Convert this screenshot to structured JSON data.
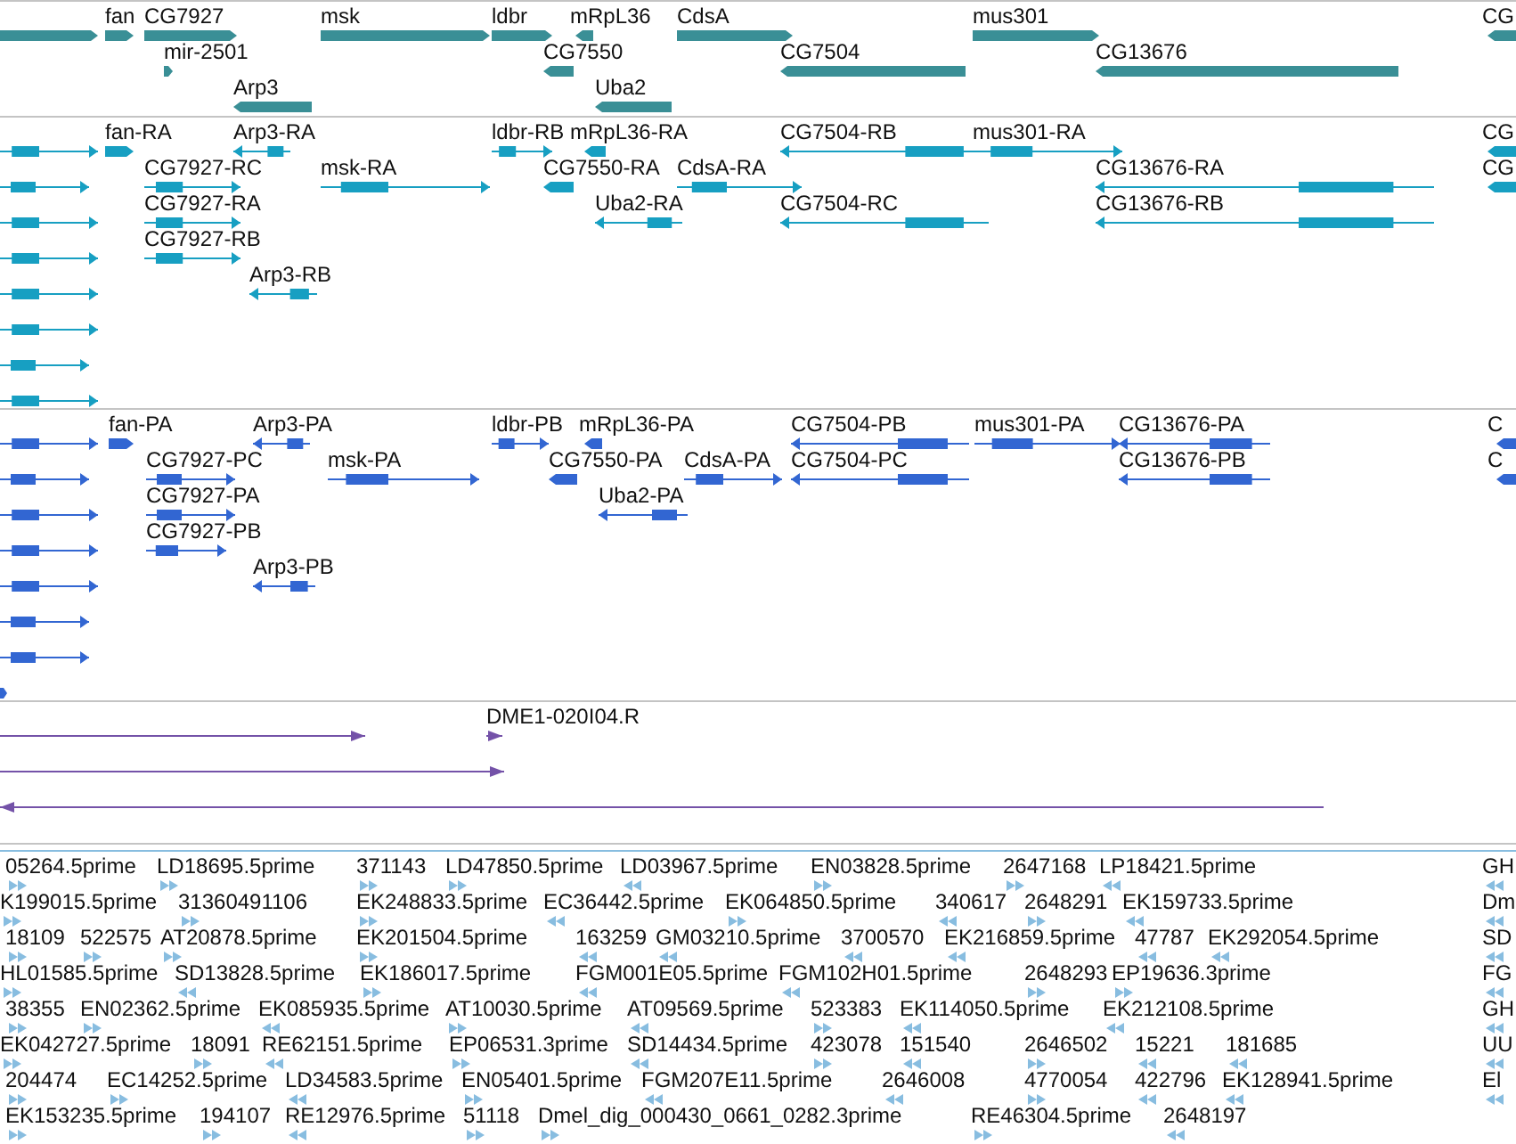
{
  "tracks": [
    {
      "kind": "gene",
      "color": "#3a8f96",
      "lanes": [
        {
          "features": [
            {
              "reverse": false
            },
            {
              "label": "fan",
              "reverse": false
            },
            {
              "label": "CG7927",
              "reverse": false
            },
            {
              "label": "msk",
              "reverse": false
            },
            {
              "label": "ldbr",
              "reverse": false
            },
            {
              "label": "mRpL36",
              "reverse": true
            },
            {
              "label": "CdsA",
              "reverse": false
            },
            {
              "label": "mus301",
              "reverse": false
            },
            {
              "label": "CG",
              "reverse": true
            }
          ]
        },
        {
          "features": [
            {
              "label": "mir-2501",
              "reverse": false
            },
            {
              "label": "CG7550",
              "reverse": true
            },
            {
              "label": "CG7504",
              "reverse": true
            },
            {
              "label": "CG13676",
              "reverse": true
            }
          ]
        },
        {
          "features": [
            {
              "label": "Arp3",
              "reverse": true
            },
            {
              "label": "Uba2",
              "reverse": true
            }
          ]
        }
      ]
    },
    {
      "kind": "transcript",
      "color": "#179fc2",
      "lanes": [
        {
          "features": [
            {
              "reverse": false
            },
            {
              "label": "fan-RA",
              "reverse": false
            },
            {
              "label": "Arp3-RA",
              "reverse": true
            },
            {
              "label": "ldbr-RB",
              "reverse": false
            },
            {
              "label": "mRpL36-RA",
              "reverse": true
            },
            {
              "label": "CG7504-RB",
              "reverse": true
            },
            {
              "label": "mus301-RA",
              "reverse": false
            },
            {
              "label": "CG",
              "reverse": true
            }
          ]
        },
        {
          "features": [
            {
              "reverse": false
            },
            {
              "label": "CG7927-RC",
              "reverse": false
            },
            {
              "label": "msk-RA",
              "reverse": false
            },
            {
              "label": "CG7550-RA",
              "reverse": true
            },
            {
              "label": "CdsA-RA",
              "reverse": false
            },
            {
              "label": "CG13676-RA",
              "reverse": true
            },
            {
              "label": "CG",
              "reverse": true
            }
          ]
        },
        {
          "features": [
            {
              "reverse": false
            },
            {
              "label": "CG7927-RA",
              "reverse": false
            },
            {
              "label": "Uba2-RA",
              "reverse": true
            },
            {
              "label": "CG7504-RC",
              "reverse": true
            },
            {
              "label": "CG13676-RB",
              "reverse": true
            }
          ]
        },
        {
          "features": [
            {
              "reverse": false
            },
            {
              "label": "CG7927-RB",
              "reverse": false
            }
          ]
        },
        {
          "features": [
            {
              "reverse": false
            },
            {
              "label": "Arp3-RB",
              "reverse": true
            }
          ]
        },
        {
          "features": [
            {
              "reverse": false
            }
          ]
        },
        {
          "features": [
            {
              "reverse": false
            }
          ]
        },
        {
          "features": [
            {
              "reverse": false
            }
          ]
        }
      ]
    },
    {
      "kind": "protein",
      "color": "#3266d2",
      "lanes": [
        {
          "features": [
            {
              "reverse": false
            },
            {
              "label": "fan-PA",
              "reverse": false
            },
            {
              "label": "Arp3-PA",
              "reverse": true
            },
            {
              "label": "ldbr-PB",
              "reverse": false
            },
            {
              "label": "mRpL36-PA",
              "reverse": true
            },
            {
              "label": "CG7504-PB",
              "reverse": true
            },
            {
              "label": "mus301-PA",
              "reverse": false
            },
            {
              "label": "CG13676-PA",
              "reverse": true
            },
            {
              "label": "C",
              "reverse": true
            }
          ]
        },
        {
          "features": [
            {
              "reverse": false
            },
            {
              "label": "CG7927-PC",
              "reverse": false
            },
            {
              "label": "msk-PA",
              "reverse": false
            },
            {
              "label": "CG7550-PA",
              "reverse": true
            },
            {
              "label": "CdsA-PA",
              "reverse": false
            },
            {
              "label": "CG7504-PC",
              "reverse": true
            },
            {
              "label": "CG13676-PB",
              "reverse": true
            },
            {
              "label": "C",
              "reverse": true
            }
          ]
        },
        {
          "features": [
            {
              "reverse": false
            },
            {
              "label": "CG7927-PA",
              "reverse": false
            },
            {
              "label": "Uba2-PA",
              "reverse": true
            }
          ]
        },
        {
          "features": [
            {
              "reverse": false
            },
            {
              "label": "CG7927-PB",
              "reverse": false
            }
          ]
        },
        {
          "features": [
            {
              "reverse": false
            },
            {
              "label": "Arp3-PB",
              "reverse": true
            }
          ]
        },
        {
          "features": [
            {
              "reverse": false
            }
          ]
        },
        {
          "features": [
            {
              "reverse": false
            }
          ]
        },
        {
          "features": [
            {
              "reverse": false
            }
          ]
        }
      ]
    },
    {
      "kind": "alignment",
      "color": "#7452a8",
      "lanes": [
        {
          "features": [
            {
              "reverse": false
            },
            {
              "label": "DME1-020I04.R",
              "reverse": false
            }
          ]
        },
        {
          "features": [
            {
              "reverse": false
            }
          ]
        },
        {
          "features": [
            {
              "reverse": true
            }
          ]
        }
      ]
    },
    {
      "kind": "est",
      "color": "#88bde0",
      "lanes": [
        {
          "features": [
            {
              "label": "05264.5prime",
              "reverse": false
            },
            {
              "label": "LD18695.5prime",
              "reverse": false
            },
            {
              "label": "371143",
              "reverse": false
            },
            {
              "label": "LD47850.5prime",
              "reverse": false
            },
            {
              "label": "LD03967.5prime",
              "reverse": true
            },
            {
              "label": "EN03828.5prime",
              "reverse": false
            },
            {
              "label": "2647168",
              "reverse": false
            },
            {
              "label": "LP18421.5prime",
              "reverse": true
            },
            {
              "label": "GH",
              "reverse": true
            }
          ]
        },
        {
          "features": [
            {
              "label": "K199015.5prime",
              "reverse": false
            },
            {
              "label": "31360491106",
              "reverse": false
            },
            {
              "label": "EK248833.5prime",
              "reverse": false
            },
            {
              "label": "EC36442.5prime",
              "reverse": true
            },
            {
              "label": "EK064850.5prime",
              "reverse": false
            },
            {
              "label": "340617",
              "reverse": true
            },
            {
              "label": "2648291",
              "reverse": false
            },
            {
              "label": "EK159733.5prime",
              "reverse": true
            },
            {
              "label": "Dm",
              "reverse": true
            }
          ]
        },
        {
          "features": [
            {
              "label": "18109",
              "reverse": false
            },
            {
              "label": "522575",
              "reverse": false
            },
            {
              "label": "AT20878.5prime",
              "reverse": false
            },
            {
              "label": "EK201504.5prime",
              "reverse": false
            },
            {
              "label": "163259",
              "reverse": true
            },
            {
              "label": "GM03210.5prime",
              "reverse": true
            },
            {
              "label": "3700570",
              "reverse": true
            },
            {
              "label": "EK216859.5prime",
              "reverse": true
            },
            {
              "label": "47787",
              "reverse": true
            },
            {
              "label": "EK292054.5prime",
              "reverse": true
            },
            {
              "label": "SD",
              "reverse": true
            }
          ]
        },
        {
          "features": [
            {
              "label": "HL01585.5prime",
              "reverse": false
            },
            {
              "label": "SD13828.5prime",
              "reverse": true
            },
            {
              "label": "EK186017.5prime",
              "reverse": false
            },
            {
              "label": "FGM001E05.5prime",
              "reverse": true
            },
            {
              "label": "FGM102H01.5prime",
              "reverse": true
            },
            {
              "label": "2648293",
              "reverse": false
            },
            {
              "label": "EP19636.3prime",
              "reverse": false
            },
            {
              "label": "FG",
              "reverse": true
            }
          ]
        },
        {
          "features": [
            {
              "label": "38355",
              "reverse": false
            },
            {
              "label": "EN02362.5prime",
              "reverse": false
            },
            {
              "label": "EK085935.5prime",
              "reverse": true
            },
            {
              "label": "AT10030.5prime",
              "reverse": false
            },
            {
              "label": "AT09569.5prime",
              "reverse": true
            },
            {
              "label": "523383",
              "reverse": false
            },
            {
              "label": "EK114050.5prime",
              "reverse": true
            },
            {
              "label": "EK212108.5prime",
              "reverse": true
            },
            {
              "label": "GH",
              "reverse": true
            }
          ]
        },
        {
          "features": [
            {
              "label": "EK042727.5prime",
              "reverse": false
            },
            {
              "label": "18091",
              "reverse": false
            },
            {
              "label": "RE62151.5prime",
              "reverse": true
            },
            {
              "label": "EP06531.3prime",
              "reverse": false
            },
            {
              "label": "SD14434.5prime",
              "reverse": true
            },
            {
              "label": "423078",
              "reverse": false
            },
            {
              "label": "151540",
              "reverse": true
            },
            {
              "label": "2646502",
              "reverse": false
            },
            {
              "label": "15221",
              "reverse": true
            },
            {
              "label": "181685",
              "reverse": true
            },
            {
              "label": "UU",
              "reverse": true
            }
          ]
        },
        {
          "features": [
            {
              "label": "204474",
              "reverse": false
            },
            {
              "label": "EC14252.5prime",
              "reverse": false
            },
            {
              "label": "LD34583.5prime",
              "reverse": true
            },
            {
              "label": "EN05401.5prime",
              "reverse": false
            },
            {
              "label": "FGM207E11.5prime",
              "reverse": true
            },
            {
              "label": "2646008",
              "reverse": true
            },
            {
              "label": "4770054",
              "reverse": false
            },
            {
              "label": "422796",
              "reverse": true
            },
            {
              "label": "EK128941.5prime",
              "reverse": true
            },
            {
              "label": "El",
              "reverse": true
            }
          ]
        },
        {
          "features": [
            {
              "label": "EK153235.5prime",
              "reverse": false
            },
            {
              "label": "194107",
              "reverse": false
            },
            {
              "label": "RE12976.5prime",
              "reverse": true
            },
            {
              "label": "51118",
              "reverse": false
            },
            {
              "label": "Dmel_dig_000430_0661_0282.3prime",
              "reverse": false
            },
            {
              "label": "RE46304.5prime",
              "reverse": false
            },
            {
              "label": "2648197",
              "reverse": true
            }
          ]
        }
      ]
    }
  ]
}
